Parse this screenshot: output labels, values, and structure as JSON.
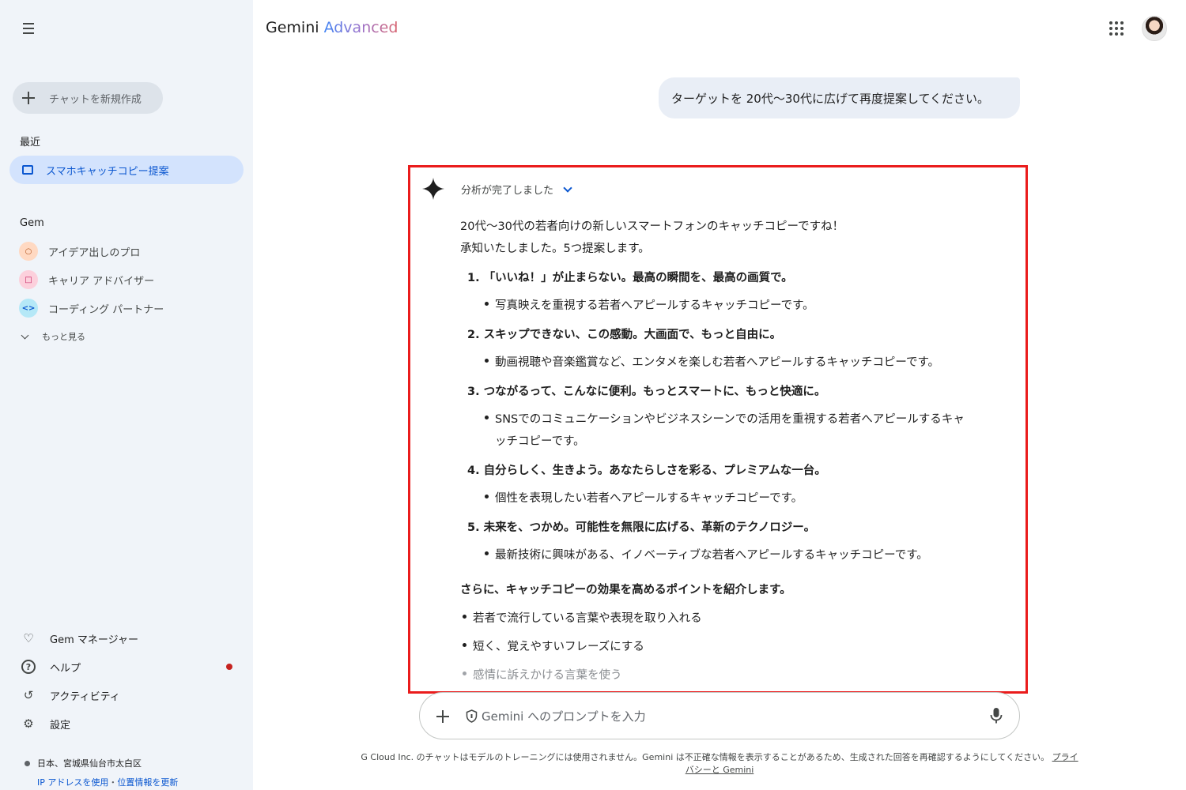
{
  "sidebar": {
    "new_chat": "チャットを新規作成",
    "recent_label": "最近",
    "recent_items": [
      "スマホキャッチコピー提案"
    ],
    "gem_label": "Gem",
    "gems": [
      {
        "label": "アイデア出しのプロ",
        "icon": "lightbulb-icon",
        "color": "#ffd9c2"
      },
      {
        "label": "キャリア アドバイザー",
        "icon": "briefcase-icon",
        "color": "#fcd0dc"
      },
      {
        "label": "コーディング パートナー",
        "icon": "code-icon",
        "color": "#b5e8f7"
      }
    ],
    "more": "もっと見る",
    "bottom": {
      "gem_manager": "Gem マネージャー",
      "help": "ヘルプ",
      "activity": "アクティビティ",
      "settings": "設定"
    },
    "location": "日本、宮城県仙台市太白区",
    "location_link1": "IP アドレスを使用",
    "location_sep": "・",
    "location_link2": "位置情報を更新"
  },
  "header": {
    "title_main": "Gemini",
    "title_tier": "Advanced"
  },
  "user_message": "ターゲットを 20代〜30代に広げて再度提案してください。",
  "response": {
    "status": "分析が完了しました",
    "intro1": "20代〜30代の若者向けの新しいスマートフォンのキャッチコピーですね！",
    "intro2": "承知いたしました。5つ提案します。",
    "items": [
      {
        "num": "1.",
        "title": "「いいね！」が止まらない。最高の瞬間を、最高の画質で。",
        "desc": [
          "写真映えを重視する若者へアピールするキャッチコピーです。"
        ]
      },
      {
        "num": "2.",
        "title": "スキップできない、この感動。大画面で、もっと自由に。",
        "desc": [
          "動画視聴や音楽鑑賞など、エンタメを楽しむ若者へアピールするキャッチコピーです。"
        ]
      },
      {
        "num": "3.",
        "title": "つながるって、こんなに便利。もっとスマートに、もっと快適に。",
        "desc": [
          "SNSでのコミュニケーションやビジネスシーンでの活用を重視する若者へアピールするキャ",
          "ッチコピーです。"
        ]
      },
      {
        "num": "4.",
        "title": "自分らしく、生きよう。あなたらしさを彩る、プレミアムな一台。",
        "desc": [
          "個性を表現したい若者へアピールするキャッチコピーです。"
        ]
      },
      {
        "num": "5.",
        "title": "未来を、つかめ。可能性を無限に広げる、革新のテクノロジー。",
        "desc": [
          "最新技術に興味がある、イノベーティブな若者へアピールするキャッチコピーです。"
        ]
      }
    ],
    "tips_heading": "さらに、キャッチコピーの効果を高めるポイントを紹介します。",
    "tips": [
      "若者で流行している言葉や表現を取り入れる",
      "短く、覚えやすいフレーズにする",
      "感情に訴えかける言葉を使う"
    ]
  },
  "prompt": {
    "placeholder": "Gemini へのプロンプトを入力"
  },
  "disclaimer": {
    "text": "G Cloud Inc. のチャットはモデルのトレーニングには使用されません。Gemini は不正確な情報を表示することがあるため、生成された回答を再確認するようにしてください。",
    "link": "プライバシーと Gemini"
  },
  "colors": {
    "sidebar_bg": "#f0f4f9",
    "accent": "#0b57d0",
    "highlight_border": "#ea1c1c"
  }
}
